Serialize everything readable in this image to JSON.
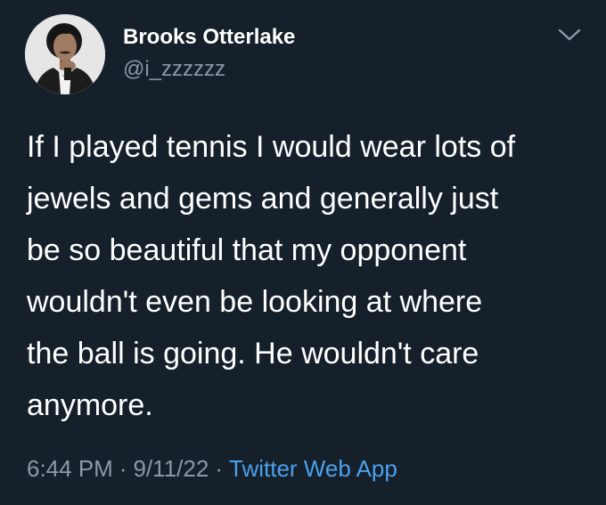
{
  "author": {
    "display_name": "Brooks Otterlake",
    "handle": "@i_zzzzzz",
    "avatar_icon": "avatar-photo"
  },
  "tweet": {
    "text": "If I played tennis I would wear lots of\njewels and gems and generally just\nbe so beautiful that my opponent\nwouldn't even be looking at where\nthe ball is going. He wouldn't care\nanymore.",
    "time": "6:44 PM",
    "date": "9/11/22",
    "separator": "·",
    "source": "Twitter Web App"
  },
  "menu": {
    "icon": "chevron-down-icon"
  },
  "colors": {
    "background": "#15202b",
    "primary_text": "#ffffff",
    "secondary_text": "#8b98a5",
    "link": "#4aa0eb"
  }
}
